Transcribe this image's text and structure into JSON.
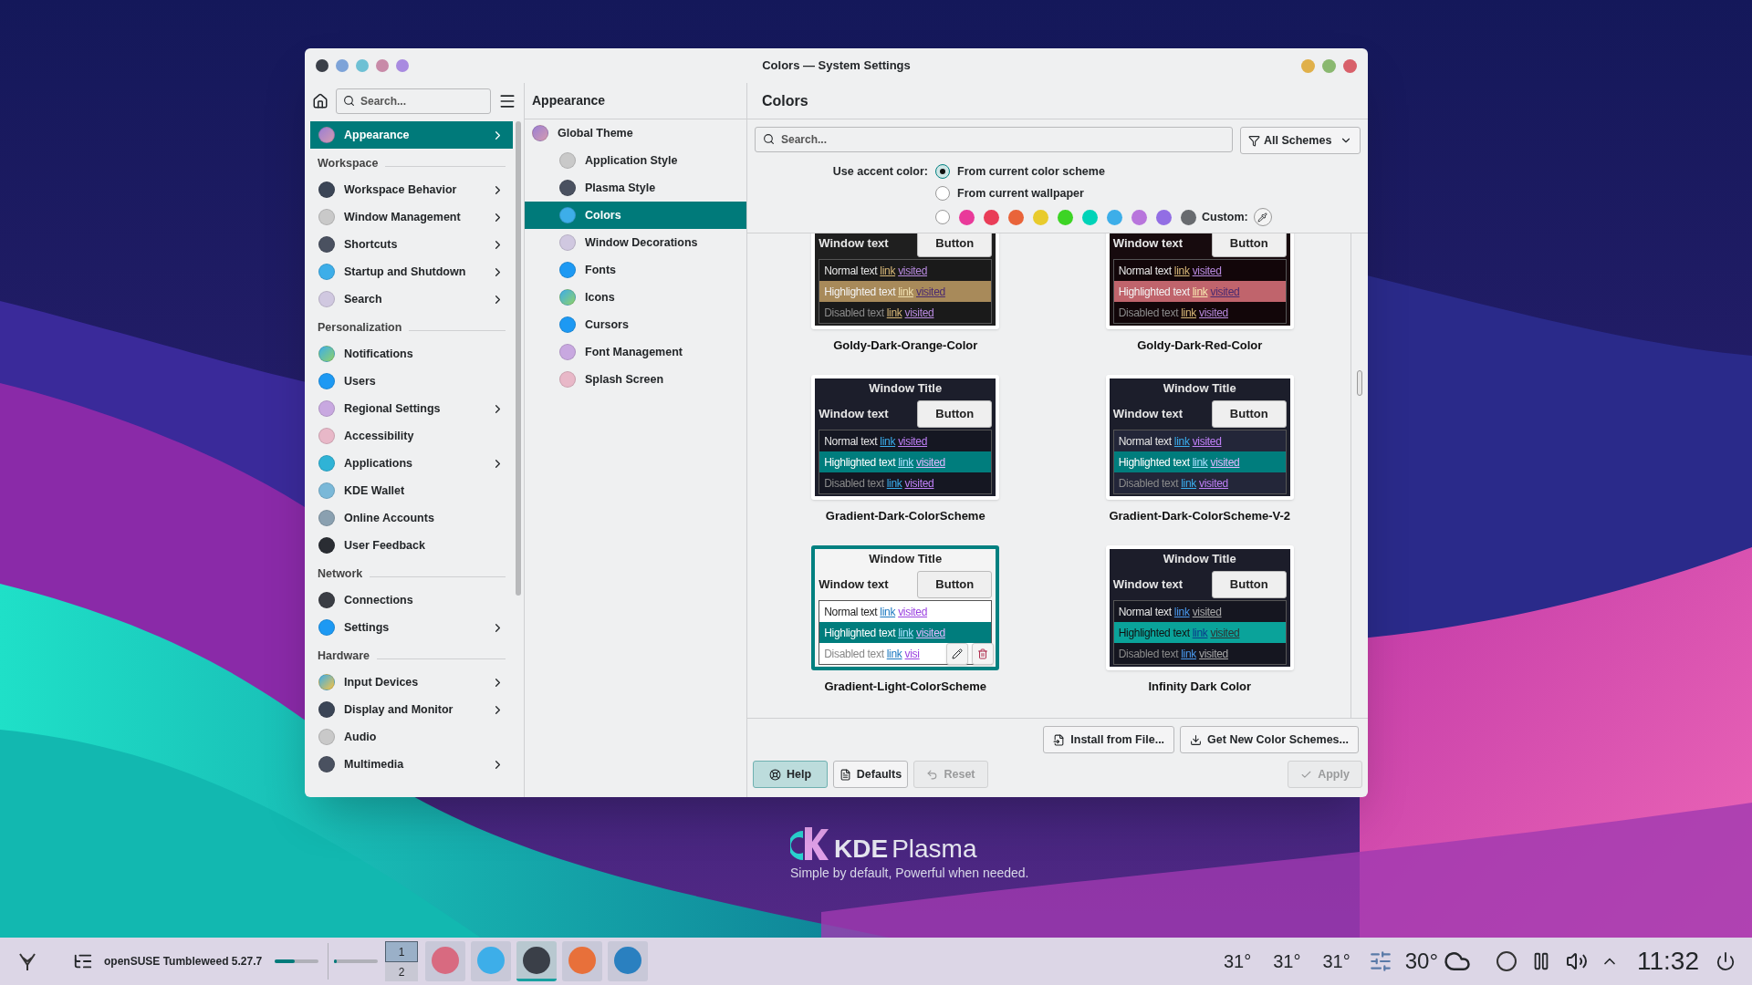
{
  "window": {
    "title": "Colors — System Settings"
  },
  "sidebar": {
    "search": {
      "placeholder": "Search..."
    },
    "items": [
      {
        "kind": "item",
        "label": "Appearance",
        "selected": true,
        "arrow": true
      },
      {
        "kind": "header",
        "label": "Workspace"
      },
      {
        "kind": "item",
        "label": "Workspace Behavior",
        "selected": false,
        "arrow": true
      },
      {
        "kind": "item",
        "label": "Window Management",
        "selected": false,
        "arrow": true
      },
      {
        "kind": "item",
        "label": "Shortcuts",
        "selected": false,
        "arrow": true
      },
      {
        "kind": "item",
        "label": "Startup and Shutdown",
        "selected": false,
        "arrow": true
      },
      {
        "kind": "item",
        "label": "Search",
        "selected": false,
        "arrow": true
      },
      {
        "kind": "header",
        "label": "Personalization"
      },
      {
        "kind": "item",
        "label": "Notifications",
        "selected": false,
        "arrow": false
      },
      {
        "kind": "item",
        "label": "Users",
        "selected": false,
        "arrow": false
      },
      {
        "kind": "item",
        "label": "Regional Settings",
        "selected": false,
        "arrow": true
      },
      {
        "kind": "item",
        "label": "Accessibility",
        "selected": false,
        "arrow": false
      },
      {
        "kind": "item",
        "label": "Applications",
        "selected": false,
        "arrow": true
      },
      {
        "kind": "item",
        "label": "KDE Wallet",
        "selected": false,
        "arrow": false
      },
      {
        "kind": "item",
        "label": "Online Accounts",
        "selected": false,
        "arrow": false
      },
      {
        "kind": "item",
        "label": "User Feedback",
        "selected": false,
        "arrow": false
      },
      {
        "kind": "header",
        "label": "Network"
      },
      {
        "kind": "item",
        "label": "Connections",
        "selected": false,
        "arrow": false
      },
      {
        "kind": "item",
        "label": "Settings",
        "selected": false,
        "arrow": true
      },
      {
        "kind": "header",
        "label": "Hardware"
      },
      {
        "kind": "item",
        "label": "Input Devices",
        "selected": false,
        "arrow": true
      },
      {
        "kind": "item",
        "label": "Display and Monitor",
        "selected": false,
        "arrow": true
      },
      {
        "kind": "item",
        "label": "Audio",
        "selected": false,
        "arrow": false
      },
      {
        "kind": "item",
        "label": "Multimedia",
        "selected": false,
        "arrow": true
      }
    ]
  },
  "subpanel": {
    "title": "Appearance",
    "items": [
      {
        "label": "Global Theme",
        "selected": false,
        "children": [
          {
            "label": "Application Style",
            "selected": false
          },
          {
            "label": "Plasma Style",
            "selected": false
          },
          {
            "label": "Colors",
            "selected": true
          },
          {
            "label": "Window Decorations",
            "selected": false
          },
          {
            "label": "Fonts",
            "selected": false
          },
          {
            "label": "Icons",
            "selected": false
          },
          {
            "label": "Cursors",
            "selected": false
          },
          {
            "label": "Font Management",
            "selected": false
          },
          {
            "label": "Splash Screen",
            "selected": false
          }
        ]
      }
    ]
  },
  "page": {
    "title": "Colors",
    "search": {
      "placeholder": "Search..."
    },
    "filter": "All Schemes",
    "accent": {
      "label": "Use accent color:",
      "options": [
        {
          "label": "From current color scheme",
          "selected": true
        },
        {
          "label": "From current wallpaper",
          "selected": false
        }
      ],
      "swatch_radio_selected": false,
      "swatches": [
        {
          "color": "#e93a9a"
        },
        {
          "color": "#e93d58"
        },
        {
          "color": "#e9643a"
        },
        {
          "color": "#e8cb2d"
        },
        {
          "color": "#3dd425"
        },
        {
          "color": "#00d3b8"
        },
        {
          "color": "#3daee9"
        },
        {
          "color": "#b875dc"
        },
        {
          "color": "#926ee4"
        },
        {
          "color": "#686b6f"
        }
      ],
      "custom_label": "Custom:"
    },
    "schemes": [
      {
        "name": "Goldy-Dark-Orange-Color",
        "kind": "goldy-orange",
        "selected": false,
        "color": "#1f1f1f",
        "window_text": "Window text",
        "button": "Button",
        "rows": [
          {
            "kind": "normal",
            "label": "Normal text",
            "link": "link",
            "visited": "visited"
          },
          {
            "kind": "highlighted",
            "label": "Highlighted text",
            "link": "link",
            "visited": "visited"
          },
          {
            "kind": "disabled",
            "label": "Disabled text",
            "link": "link",
            "visited": "visited"
          }
        ]
      },
      {
        "name": "Goldy-Dark-Red-Color",
        "kind": "goldy-red",
        "selected": false,
        "color": "#170b0e",
        "window_text": "Window text",
        "button": "Button",
        "rows": [
          {
            "kind": "normal",
            "label": "Normal text",
            "link": "link",
            "visited": "visited"
          },
          {
            "kind": "highlighted",
            "label": "Highlighted text",
            "link": "link",
            "visited": "visited"
          },
          {
            "kind": "disabled",
            "label": "Disabled text",
            "link": "link",
            "visited": "visited"
          }
        ]
      },
      {
        "name": "Gradient-Dark-ColorScheme",
        "kind": "gradient-dark",
        "selected": false,
        "title": "Window Title",
        "color": "#1c1e2b",
        "window_text": "Window text",
        "button": "Button",
        "rows": [
          {
            "kind": "normal",
            "label": "Normal text",
            "link": "link",
            "visited": "visited"
          },
          {
            "kind": "highlighted",
            "label": "Highlighted text",
            "link": "link",
            "visited": "visited"
          },
          {
            "kind": "disabled",
            "label": "Disabled text",
            "link": "link",
            "visited": "visited"
          }
        ]
      },
      {
        "name": "Gradient-Dark-ColorScheme-V-2",
        "kind": "gradient-dark-v2",
        "selected": false,
        "title": "Window Title",
        "color": "#1c1e2b",
        "window_text": "Window text",
        "button": "Button",
        "rows": [
          {
            "kind": "normal",
            "label": "Normal text",
            "link": "link",
            "visited": "visited"
          },
          {
            "kind": "highlighted",
            "label": "Highlighted text",
            "link": "link",
            "visited": "visited"
          },
          {
            "kind": "disabled",
            "label": "Disabled text",
            "link": "link",
            "visited": "visited"
          }
        ]
      },
      {
        "name": "Gradient-Light-ColorScheme",
        "kind": "gradient-light",
        "selected": true,
        "title": "Window Title",
        "color": "#f4f4f4",
        "window_text": "Window text",
        "button": "Button",
        "rows": [
          {
            "kind": "normal",
            "label": "Normal text",
            "link": "link",
            "visited": "visited"
          },
          {
            "kind": "highlighted",
            "label": "Highlighted text",
            "link": "link",
            "visited": "visited"
          },
          {
            "kind": "disabled",
            "label": "Disabled text",
            "link": "link",
            "visited": "visi"
          }
        ]
      },
      {
        "name": "Infinity Dark Color",
        "kind": "infinity",
        "selected": false,
        "title": "Window Title",
        "color": "#1c1d2a",
        "window_text": "Window text",
        "button": "Button",
        "rows": [
          {
            "kind": "normal",
            "label": "Normal text",
            "link": "link",
            "visited": "visited"
          },
          {
            "kind": "highlighted",
            "label": "Highlighted text",
            "link": "link",
            "visited": "visited"
          },
          {
            "kind": "disabled",
            "label": "Disabled text",
            "link": "link",
            "visited": "visited"
          }
        ]
      }
    ],
    "install_button": "Install from File...",
    "get_new_button": "Get New Color Schemes...",
    "footer": {
      "help": "Help",
      "defaults": "Defaults",
      "reset": "Reset",
      "reset_disabled": true,
      "apply": "Apply",
      "apply_disabled": true
    }
  },
  "desktop": {
    "brand_kde": "KDE",
    "brand_plasma": "Plasma",
    "tagline": "Simple by default, Powerful when needed."
  },
  "taskbar": {
    "title": "openSUSE Tumbleweed 5.27.7",
    "meter_1": {
      "level": 0.45
    },
    "meter_2": {
      "level": 0.05
    },
    "desktops": [
      {
        "label": "1",
        "selected": true
      },
      {
        "label": "2",
        "selected": false
      }
    ],
    "apps": [
      {
        "selected": false
      },
      {
        "selected": false
      },
      {
        "selected": true
      },
      {
        "selected": false
      },
      {
        "selected": false
      }
    ],
    "temps": [
      "31°",
      "31°",
      "31°"
    ],
    "weather": "30°",
    "clock": "11:32"
  }
}
